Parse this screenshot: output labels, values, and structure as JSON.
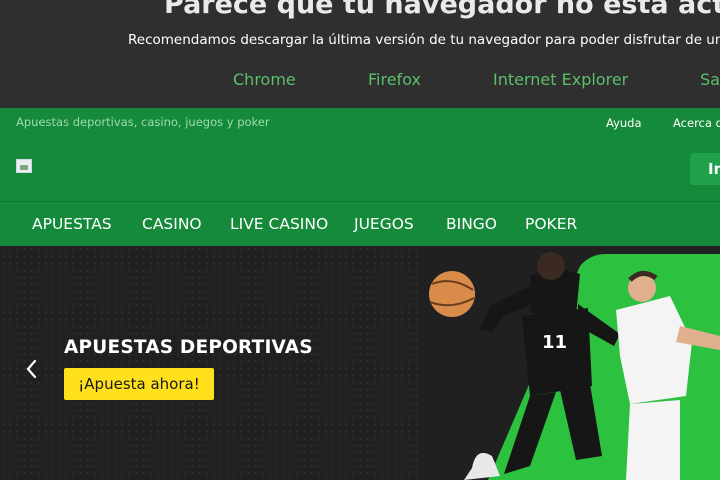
{
  "browser_notice": {
    "title": "Parece que tu navegador no está actua",
    "subtitle": "Recomendamos descargar la última versión de tu navegador para poder disfrutar de una mejor e",
    "links": [
      "Chrome",
      "Firefox",
      "Internet Explorer",
      "Sa"
    ]
  },
  "header": {
    "tagline": "Apuestas deportivas, casino, juegos y poker",
    "help_link": "Ayuda",
    "about_link": "Acerca d",
    "login_label": "In"
  },
  "nav": {
    "items": [
      "APUESTAS",
      "CASINO",
      "LIVE CASINO",
      "JUEGOS",
      "BINGO",
      "POKER"
    ]
  },
  "hero": {
    "title": "APUESTAS DEPORTIVAS",
    "cta_label": "¡Apuesta ahora!",
    "player_number": "11"
  },
  "colors": {
    "brand_green": "#158a3a",
    "notice_bg": "#2f2f2f",
    "link_green": "#5cbf6a",
    "cta_yellow": "#ffe01b",
    "hero_bg": "#202020",
    "hero_accent_green": "#2cc13e"
  },
  "icons": {
    "carousel_prev": "chevron-left-icon",
    "logo": "broken-image-icon"
  }
}
